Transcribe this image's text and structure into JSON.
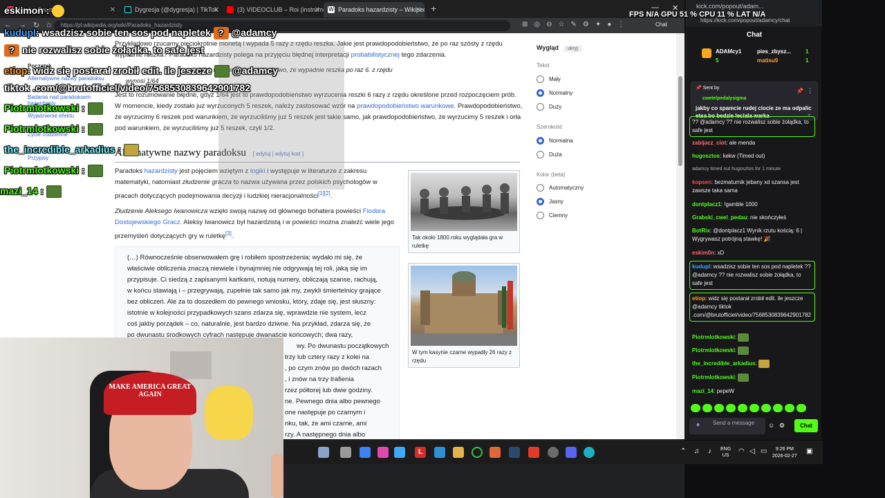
{
  "browser": {
    "tabs": [
      {
        "label": "tiktok - Search",
        "favicon": "tiktok-icon"
      },
      {
        "label": "Dygresja (@dygresja) | TikTok",
        "favicon": "tiktok-icon"
      },
      {
        "label": "(3) VIDEOCLUB – Roi (instrumental)",
        "favicon": "youtube-icon"
      },
      {
        "label": "Paradoks hazardzisty – Wikipedia",
        "favicon": "wikipedia-icon"
      }
    ],
    "url": "https://pl.wikipedia.org/wiki/Paradoks_hazardzisty",
    "chat_label": "Chat"
  },
  "wiki": {
    "toc": {
      "title": "Początek",
      "items": [
        "Alternatywne nazwy paradoksu",
        "Badania nad paradoksem hazardzisty",
        "Wyjaśnienie efektu",
        "Życie codzienne",
        "Przypisy"
      ]
    },
    "intro": [
      "Przykładowo rzucamy pięciokrotnie monetą i wypada 5 razy z rzędu reszka. Jakie jest prawdopodobieństwo, że po raz szósty z rzędu",
      "wypadnie reszka? Paradoks hazardzisty polega na przyjęciu błędnej interpretacji",
      "probabilistycznej",
      "tego zdarzenia."
    ],
    "math1": "1/64, więc prawdopodobieństwo, że wypadnie reszka po raz 6. z rzędu",
    "math2": "wynosi 1/64",
    "para2": [
      "Jest to rozumowanie błędne, gdyż 1/64 jest to prawdopodobieństwo wyrzucenia reszki 6 razy z rzędu określone przed rozpoczęciem",
      "prób. W momencie, kiedy zostało już wyrzuconych 5 reszek, należy zastosować wzór na",
      "prawdopodobieństwo warunkowe",
      ". Prawdopodobieństwo, że wyrzucimy 6 reszek pod warunkiem, że wyrzuciliśmy już 5 reszek jest takie samo, jak prawdopodobieństwo,",
      "że wyrzucimy 5 reszek i orła pod warunkiem, że wyrzuciliśmy już 5 reszek, czyli 1/2."
    ],
    "h2": "Alternatywne nazwy paradoksu",
    "h2_edit": "[ edytuj | edytuj kod ]",
    "para3": [
      "Paradoks",
      "hazardzisty",
      "jest pojęciem wziętym z",
      "logiki",
      "i występuje w literaturze z zakresu",
      "matematyki, natomiast",
      "złudzenie gracza",
      "to nazwa używana przez polskich psychologów w",
      "pracach dotyczących podejmowania decyzji i ludzkiej nieracjonalności",
      "[1][2]",
      "."
    ],
    "para4": [
      "Złudzenie Aleksego Iwanowicza",
      "wzięło swoją nazwę od głównego bohatera powieści",
      "Fiodora",
      "Dostojewskiego",
      "Gracz",
      ". Aleksy Iwanowicz był hazardzistą i w powieści można znaleźć wiele",
      "jego przemyśleń dotyczących gry w ruletkę",
      "[3]",
      "."
    ],
    "quote_lines": [
      "(…) Równocześnie obserwowałem grę i robiłem spostrzeżenia; wydało mi się, że",
      "właściwie obliczenia znaczą niewiele i bynajmniej nie odgrywają tej roli, jaką się im",
      "przypisuje. Ci siedzą z zapisanymi kartkami, notują numery, obliczają szanse, rachują,",
      "w końcu stawiają i – przegrywają, zupełnie tak samo jak my, zwykli śmiertelnicy grające",
      "bez obliczeń. Ale za to doszedłem do pewnego wniosku, który, zdaje się, jest słuszny:",
      "istotnie w kolejności przypadkowych szans zdarza się, wprawdzie nie system, lecz",
      "coś jakby porządek – co, naturalnie, jest bardzo dziwne. Na przykład, zdarza się, że",
      "po dwunastu środkowych cyfrach następuje dwanaście końcowych; dwa razy,",
      "wy. Po dwunastu początkowych",
      "trzy lub cztery razy z kolei na",
      ", po czym znów po dwóch razach",
      ", i znów na trzy trafienia",
      "rzez półtorej lub dwie godziny.",
      "ne. Pewnego dnia albo pewnego",
      "one następuje po czarnym i",
      "nku, tak, że ami czarne, ami",
      "rzy. A następnego dnia albo"
    ],
    "figures": [
      {
        "caption": "Tak około 1800 roku wyglądała gra w ruletkę"
      },
      {
        "caption": "W tym kasynie czarne wypadły 26 razy z rzędu"
      }
    ],
    "appearance": {
      "title": "Wygląd",
      "hide": "ukryj",
      "text_label": "Tekst",
      "text_options": [
        "Mały",
        "Normalny",
        "Duży"
      ],
      "text_selected": "Normalny",
      "width_label": "Szerokość",
      "width_options": [
        "Normalna",
        "Duża"
      ],
      "width_selected": "Normalna",
      "color_label": "Kolor (beta)",
      "color_options": [
        "Automatyczny",
        "Jasny",
        "Ciemny"
      ],
      "color_selected": "Jasny"
    }
  },
  "overlay": {
    "perf": "FPS N/A  GPU 51 %  CPU 11 %  LAT N/A",
    "lines": [
      {
        "name": "eskimon",
        "text": ":",
        "emote": "laugh-emote",
        "color": "#ffffff"
      },
      {
        "name": "kudupl",
        "text": ": wsadzisz sobie ten sos pod napletek",
        "emote": "question-emote",
        "tail": "@adamcy",
        "color": "#4aa3ff"
      },
      {
        "name": "",
        "text": "nie rozwalisz sobie żołądka, to safe jest",
        "emote": "question-emote",
        "color": "#ffffff"
      },
      {
        "name": "etiop",
        "text": ": widz się postarał zrobił edit. ile jeszcze",
        "emote": "pepe-emote",
        "tail": "@adamcy",
        "color": "#ff9f2e"
      },
      {
        "name": "",
        "text": "tiktok .com/@brutofficiel/video/7568530839642901782",
        "color": "#ffffff"
      },
      {
        "name": "Piotrmlotkowski",
        "text": ":",
        "emote": "pepe-emote",
        "color": "#53fc18"
      },
      {
        "name": "Piotrmlotkowski",
        "text": ":",
        "emote": "pepe-emote",
        "color": "#53fc18"
      },
      {
        "name": "the_incredible_arkadius",
        "text": ":",
        "emote": "tank-emote",
        "color": "#7cf2ff"
      },
      {
        "name": "Piotrmlotkowski",
        "text": ":",
        "emote": "pepe-emote",
        "color": "#53fc18"
      },
      {
        "name": "mazi_14",
        "text": ":",
        "emote": "pepe-emote",
        "color": "#53fc18"
      }
    ]
  },
  "kick": {
    "url": "kick.com/popout/adam...",
    "url2": "https://kick.com/popout/adamcy/chat",
    "title": "Chat",
    "leaderboard": [
      {
        "name": "ADAMcy1",
        "value": "5"
      },
      {
        "name": "pies_zbysz...",
        "value": "1"
      },
      {
        "name": "matisu9",
        "value": "1"
      }
    ],
    "pinned": {
      "label": "Sent by",
      "user": "cwelelpedalysigma",
      "text": "jakby co spamcie rudej ciocie ze ma odpalic etsa bo bedzie leciala warka"
    },
    "messages": [
      {
        "user": "",
        "text": "?? @adamcy ?? nie rozwalisz sobie żołądka, to safe jest",
        "color": "#fff",
        "hl": true
      },
      {
        "user": "zabijacz_ciot",
        "text": ": ale menda",
        "color": "#ff6b6b"
      },
      {
        "user": "hugosztos",
        "text": ": kekw (Timed out)",
        "color": "#53fc18"
      },
      {
        "user": "",
        "text": "adamcy timed out hugosztos for 1 minute",
        "color": "#adadb8",
        "sys": true
      },
      {
        "user": "kopsen",
        "text": ": bezmaturnik jebany xd szansa jest zawsze taka sama",
        "color": "#ff4d4d"
      },
      {
        "user": "dontplacz1",
        "text": ": !gamble 1000",
        "color": "#53fc18"
      },
      {
        "user": "Grabski_cwel_pedau",
        "text": ": nie skończyłeś",
        "color": "#53fc18"
      },
      {
        "user": "BotRix",
        "text": ": @dontplacz1 Wynik rzutu kością: 6 | Wygrywasz potrójną stawkę! 🎉",
        "color": "#53fc18"
      },
      {
        "user": "eskim0n",
        "text": ": xD",
        "color": "#ffffff"
      },
      {
        "user": "kudupl",
        "text": ": wsadzisz sobie ten sos pod napletek ?? @adamcy ?? nie rozwalisz sobie żołądka, to safe jest",
        "color": "#4aa3ff",
        "hl": true
      },
      {
        "user": "etiop",
        "text": ": widz się postarał zrobił edit. ile jeszcze @adamcy tiktok .com/@brutofficiel/video/7568530839642901782",
        "color": "#ff9f2e",
        "hl": true
      },
      {
        "user": "Piotrmlotkowski",
        "text": ":",
        "color": "#53fc18",
        "emote": true
      },
      {
        "user": "Piotrmlotkowski",
        "text": ":",
        "color": "#53fc18",
        "emote": true
      },
      {
        "user": "the_incredible_arkadius",
        "text": ":",
        "color": "#53fc18",
        "emote": true
      },
      {
        "user": "Piotrmlotkowski",
        "text": ":",
        "color": "#53fc18",
        "emote": true
      },
      {
        "user": "mazi_14",
        "text": ": pepeW",
        "color": "#53fc18"
      }
    ],
    "input_placeholder": "Send a message",
    "send_label": "Chat"
  },
  "taskbar": {
    "lang_top": "ENG",
    "lang_bottom": "US",
    "time": "9:26 PM",
    "date": "2026-02-27"
  },
  "webcam": {
    "hat_text": "MAKE AMERICA GREAT AGAIN"
  }
}
